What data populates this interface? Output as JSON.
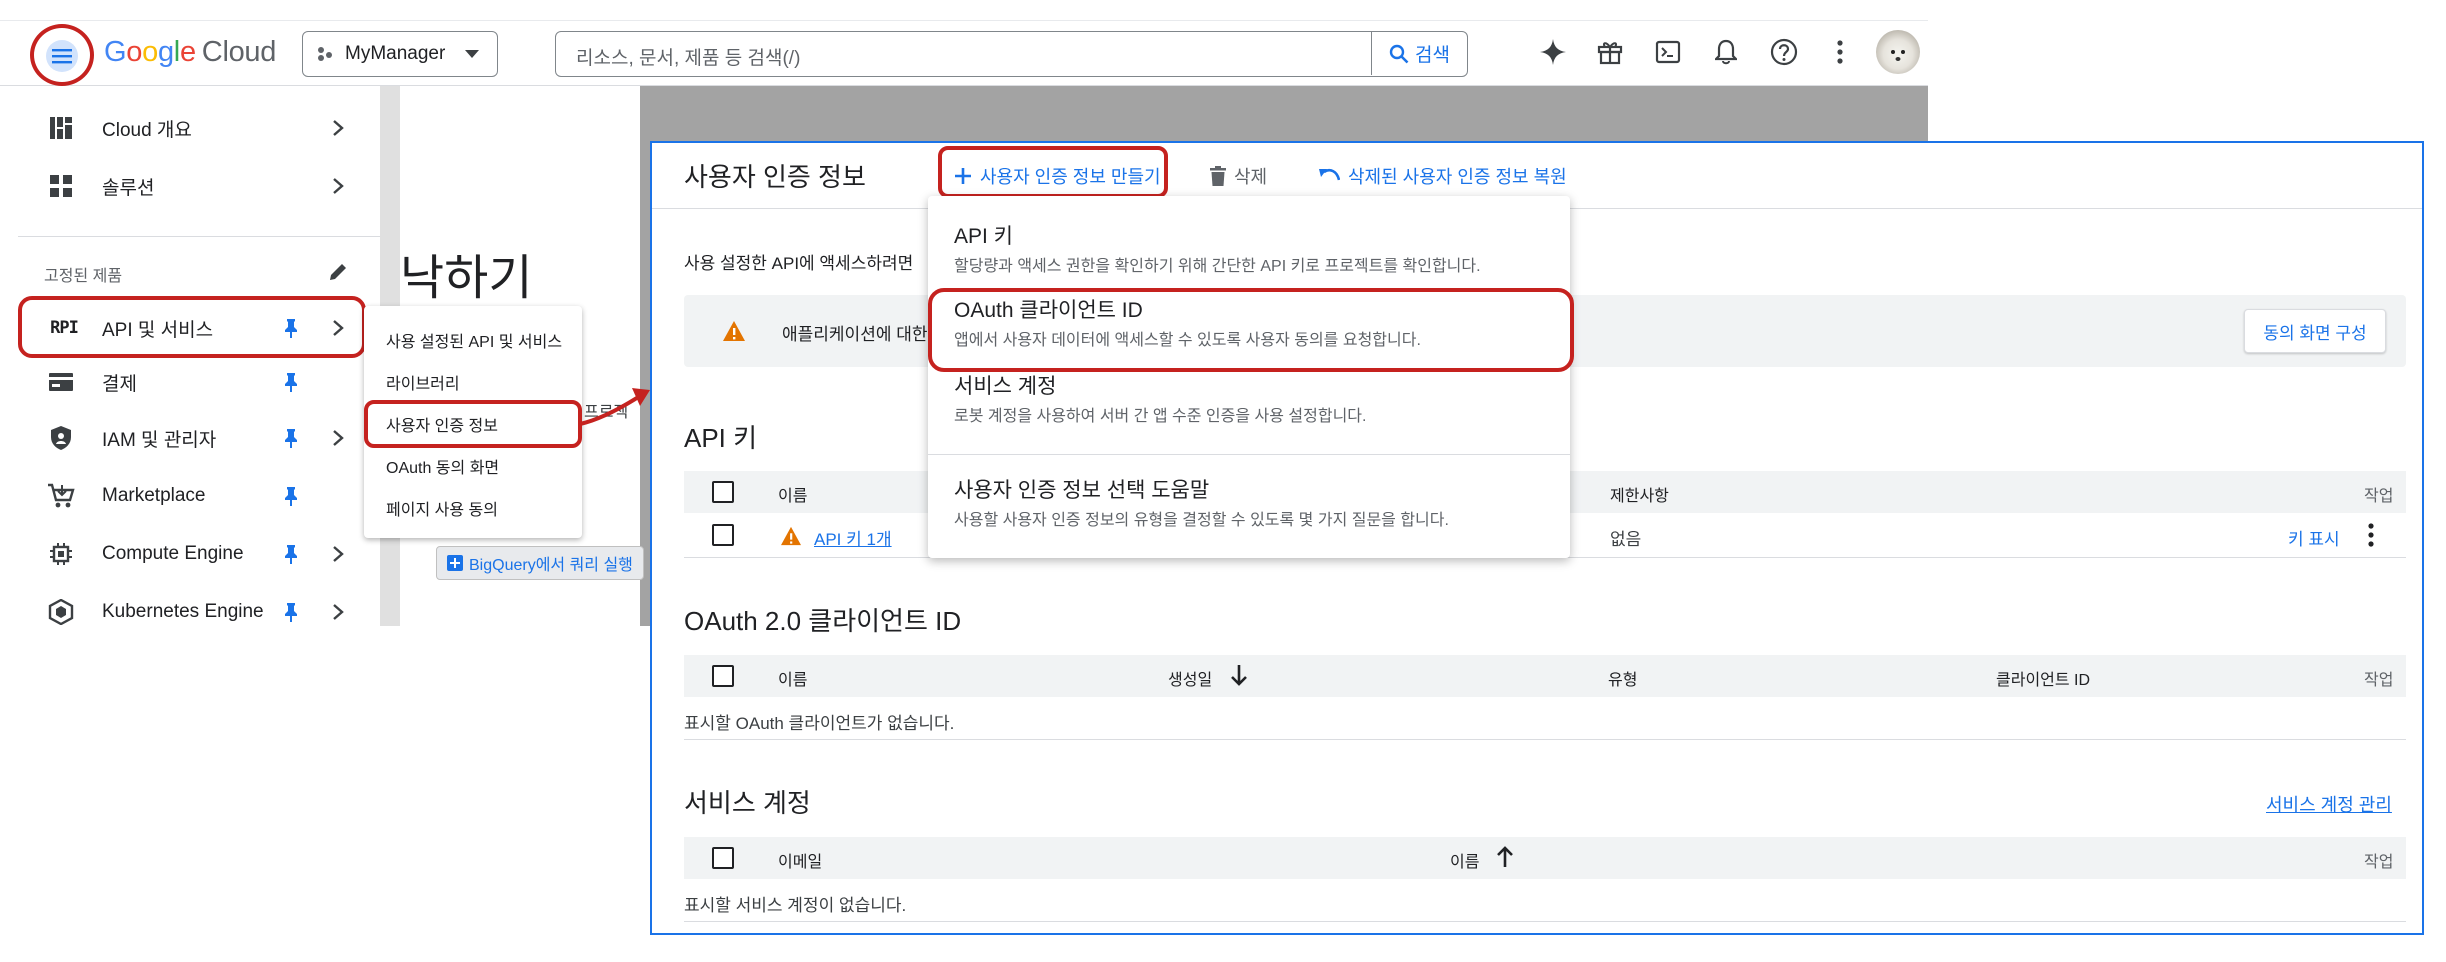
{
  "topbar": {
    "menu_icon": "hamburger-menu-icon",
    "logo_google": [
      "G",
      "o",
      "o",
      "g",
      "l",
      "e"
    ],
    "logo_cloud": "Cloud",
    "project": "MyManager",
    "search_placeholder": "리소스, 문서, 제품 등 검색(/)",
    "search_button": "검색",
    "icons": [
      "gemini-sparkle-icon",
      "gift-icon",
      "cloud-shell-icon",
      "notifications-bell-icon",
      "help-icon",
      "more-vert-icon",
      "user-avatar"
    ]
  },
  "sidebar": {
    "top_items": [
      {
        "label": "Cloud 개요",
        "icon": "dashboard-icon"
      },
      {
        "label": "솔루션",
        "icon": "grid-icon"
      }
    ],
    "pinned_title": "고정된 제품",
    "pinned_items": [
      {
        "label": "API 및 서비스",
        "icon": "api-icon",
        "pinned": true,
        "chevron": true
      },
      {
        "label": "결제",
        "icon": "billing-card-icon",
        "pinned": true,
        "chevron": false
      },
      {
        "label": "IAM 및 관리자",
        "icon": "shield-icon",
        "pinned": true,
        "chevron": true
      },
      {
        "label": "Marketplace",
        "icon": "cart-icon",
        "pinned": true,
        "chevron": false
      },
      {
        "label": "Compute Engine",
        "icon": "chip-icon",
        "pinned": true,
        "chevron": true
      },
      {
        "label": "Kubernetes Engine",
        "icon": "kubernetes-icon",
        "pinned": true,
        "chevron": true
      }
    ]
  },
  "submenu": {
    "items": [
      "사용 설정된 API 및 서비스",
      "라이브러리",
      "사용자 인증 정보",
      "OAuth 동의 화면",
      "페이지 사용 동의"
    ]
  },
  "background": {
    "heading_fragment": "낙하기",
    "fragment_text": "프로젝",
    "bigquery_button": "BigQuery에서 쿼리 실행"
  },
  "credentials": {
    "title": "사용자 인증 정보",
    "create_button": "사용자 인증 정보 만들기",
    "delete_button": "삭제",
    "restore_button": "삭제된 사용자 인증 정보 복원",
    "intro": "사용 설정한 API에 액세스하려면",
    "warning_text": "애플리케이션에 대한",
    "consent_button": "동의 화면 구성",
    "api_keys": {
      "title": "API 키",
      "columns": [
        "이름",
        "제한사항",
        "작업"
      ],
      "rows": [
        {
          "name": "API 키 1개",
          "restriction": "없음",
          "action": "키 표시"
        }
      ]
    },
    "oauth": {
      "title": "OAuth 2.0 클라이언트 ID",
      "columns": [
        "이름",
        "생성일",
        "유형",
        "클라이언트 ID",
        "작업"
      ],
      "empty": "표시할 OAuth 클라이언트가 없습니다."
    },
    "service_accounts": {
      "title": "서비스 계정",
      "manage_link": "서비스 계정 관리",
      "columns": [
        "이메일",
        "이름",
        "작업"
      ],
      "empty": "표시할 서비스 계정이 없습니다."
    }
  },
  "dropdown": {
    "items": [
      {
        "title": "API 키",
        "desc": "할당량과 액세스 권한을 확인하기 위해 간단한 API 키로 프로젝트를 확인합니다."
      },
      {
        "title": "OAuth 클라이언트 ID",
        "desc": "앱에서 사용자 데이터에 액세스할 수 있도록 사용자 동의를 요청합니다."
      },
      {
        "title": "서비스 계정",
        "desc": "로봇 계정을 사용하여 서버 간 앱 수준 인증을 사용 설정합니다."
      },
      {
        "title": "사용자 인증 정보 선택 도움말",
        "desc": "사용할 사용자 인증 정보의 유형을 결정할 수 있도록 몇 가지 질문을 합니다."
      }
    ]
  },
  "colors": {
    "accent": "#1a73e8",
    "highlight": "#c5221f",
    "warning": "#e37400",
    "pin": "#1a73e8"
  }
}
